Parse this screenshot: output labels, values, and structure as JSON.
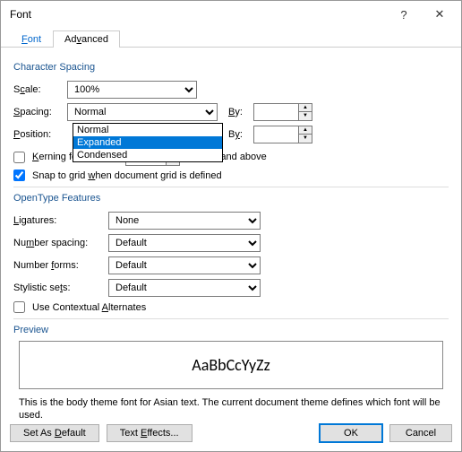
{
  "window": {
    "title": "Font"
  },
  "tabs": {
    "font": "Font",
    "advanced": "Advanced"
  },
  "charspacing": {
    "group": "Character Spacing",
    "scale_label": "Scale:",
    "scale_value": "100%",
    "spacing_label": "Spacing:",
    "spacing_value": "Normal",
    "spacing_options": {
      "normal": "Normal",
      "expanded": "Expanded",
      "condensed": "Condensed"
    },
    "position_label": "Position:",
    "by_label": "By:",
    "kerning_label": "Kerning for fonts:",
    "kerning_suffix": "Points and above",
    "snap_label": "Snap to grid when document grid is defined"
  },
  "opentype": {
    "group": "OpenType Features",
    "ligatures_label": "Ligatures:",
    "ligatures_value": "None",
    "numspacing_label": "Number spacing:",
    "numspacing_value": "Default",
    "numforms_label": "Number forms:",
    "numforms_value": "Default",
    "stylistic_label": "Stylistic sets:",
    "stylistic_value": "Default",
    "contextual_label": "Use Contextual Alternates"
  },
  "preview": {
    "label": "Preview",
    "sample": "AaBbCcYyZz",
    "desc": "This is the body theme font for Asian text. The current document theme defines which font will be used."
  },
  "buttons": {
    "set_default": "Set As Default",
    "text_effects": "Text Effects...",
    "ok": "OK",
    "cancel": "Cancel"
  }
}
